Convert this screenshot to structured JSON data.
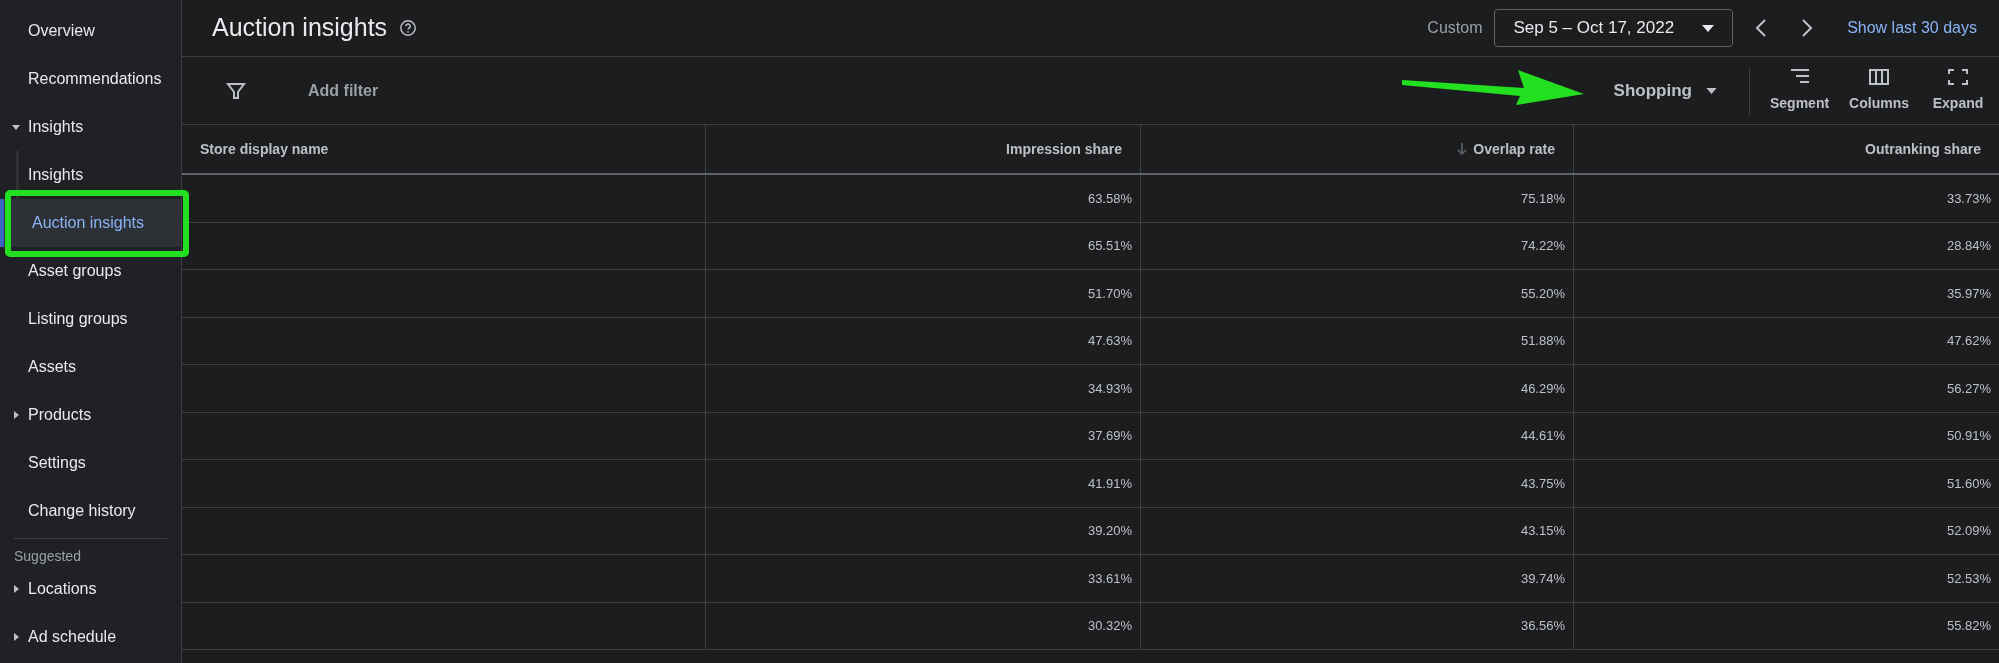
{
  "sidebar": {
    "items": [
      {
        "label": "Overview",
        "selected": false
      },
      {
        "label": "Recommendations",
        "selected": false
      },
      {
        "label": "Insights",
        "selected": false,
        "expanded": true,
        "children": [
          {
            "label": "Insights",
            "selected": false
          },
          {
            "label": "Auction insights",
            "selected": true
          }
        ]
      },
      {
        "label": "Asset groups",
        "selected": false
      },
      {
        "label": "Listing groups",
        "selected": false
      },
      {
        "label": "Assets",
        "selected": false
      },
      {
        "label": "Products",
        "selected": false,
        "expanded": false
      },
      {
        "label": "Settings",
        "selected": false
      },
      {
        "label": "Change history",
        "selected": false
      }
    ],
    "suggested": {
      "heading": "Suggested",
      "items": [
        {
          "label": "Locations",
          "selected": false,
          "expanded": false
        },
        {
          "label": "Ad schedule",
          "selected": false,
          "expanded": false
        }
      ]
    }
  },
  "header": {
    "title": "Auction insights",
    "date_label": "Custom",
    "date_range": "Sep 5 – Oct 17, 2022",
    "quick_link": "Show last 30 days"
  },
  "toolbar": {
    "filter": "Add filter",
    "campaign_type": "Shopping",
    "buttons": [
      "Segment",
      "Columns",
      "Expand"
    ]
  },
  "table": {
    "columns": [
      {
        "label": "Store display name",
        "sorted": false
      },
      {
        "label": "Impression share",
        "sorted": false
      },
      {
        "label": "Overlap rate",
        "sorted": true
      },
      {
        "label": "Outranking share",
        "sorted": false
      }
    ],
    "rows": [
      [
        "",
        "63.58%",
        "75.18%",
        "33.73%"
      ],
      [
        "",
        "65.51%",
        "74.22%",
        "28.84%"
      ],
      [
        "",
        "51.70%",
        "55.20%",
        "35.97%"
      ],
      [
        "",
        "47.63%",
        "51.88%",
        "47.62%"
      ],
      [
        "",
        "34.93%",
        "46.29%",
        "56.27%"
      ],
      [
        "",
        "37.69%",
        "44.61%",
        "50.91%"
      ],
      [
        "",
        "41.91%",
        "43.75%",
        "51.60%"
      ],
      [
        "",
        "39.20%",
        "43.15%",
        "52.09%"
      ],
      [
        "",
        "33.61%",
        "39.74%",
        "52.53%"
      ],
      [
        "",
        "30.32%",
        "36.56%",
        "55.82%"
      ]
    ]
  }
}
